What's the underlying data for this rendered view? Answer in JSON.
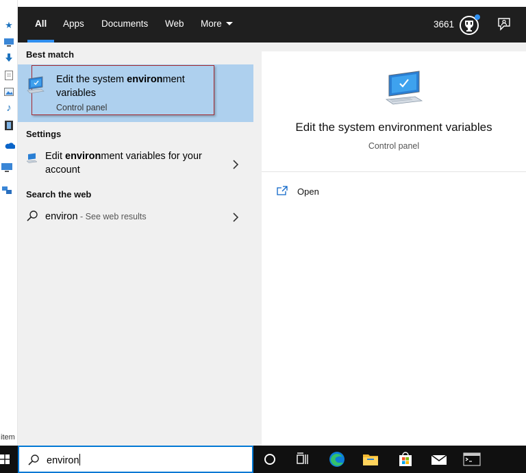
{
  "background": {
    "items_label": "item"
  },
  "topbar": {
    "tabs": [
      {
        "label": "All",
        "active": true
      },
      {
        "label": "Apps",
        "active": false
      },
      {
        "label": "Documents",
        "active": false
      },
      {
        "label": "Web",
        "active": false
      },
      {
        "label": "More",
        "active": false
      }
    ],
    "points": "3661",
    "trophy_icon": "trophy-icon",
    "feedback_icon": "feedback-icon"
  },
  "results": {
    "best_match_header": "Best match",
    "best_match": {
      "title_pre": "Edit the system ",
      "title_bold": "environ",
      "title_post": "ment variables",
      "subtitle": "Control panel"
    },
    "settings_header": "Settings",
    "settings_item": {
      "title_pre": "Edit ",
      "title_bold": "environ",
      "title_post": "ment variables for your account"
    },
    "web_header": "Search the web",
    "web_item": {
      "query": "environ",
      "suffix": " - See web results"
    }
  },
  "preview": {
    "title": "Edit the system environment variables",
    "subtitle": "Control panel",
    "open_label": "Open"
  },
  "taskbar": {
    "search_value": "environ",
    "icons": [
      "cortana-icon",
      "task-view-icon",
      "edge-icon",
      "file-explorer-icon",
      "store-icon",
      "mail-icon",
      "terminal-icon"
    ]
  },
  "colors": {
    "accent": "#0078d4",
    "selection": "#aed0ee",
    "highlight_outline": "#a4262c",
    "topbar": "#1f1f1f"
  }
}
